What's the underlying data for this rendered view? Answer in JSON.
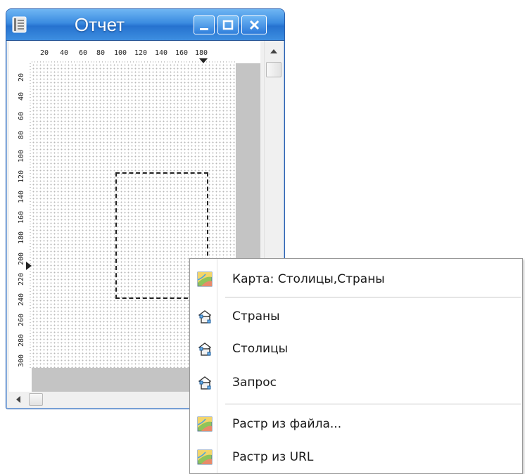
{
  "window": {
    "title": "Отчет",
    "ruler_top_ticks": [
      "20",
      "40",
      "60",
      "80",
      "100",
      "120",
      "140",
      "160",
      "180"
    ],
    "ruler_left_ticks": [
      "20",
      "40",
      "60",
      "80",
      "100",
      "120",
      "140",
      "160",
      "180",
      "200",
      "220",
      "240",
      "260",
      "280",
      "300"
    ]
  },
  "menu": {
    "items": [
      {
        "label": "Карта: Столицы,Страны",
        "icon": "raster-map-icon"
      },
      {
        "label": "Страны",
        "icon": "layer-icon"
      },
      {
        "label": "Столицы",
        "icon": "layer-icon"
      },
      {
        "label": "Запрос",
        "icon": "layer-icon"
      },
      {
        "label": "Растр из файла...",
        "icon": "raster-map-icon"
      },
      {
        "label": "Растр из URL",
        "icon": "raster-map-icon"
      }
    ]
  },
  "colors": {
    "titlebar": "#3a8be0",
    "menu_border": "#979797"
  }
}
